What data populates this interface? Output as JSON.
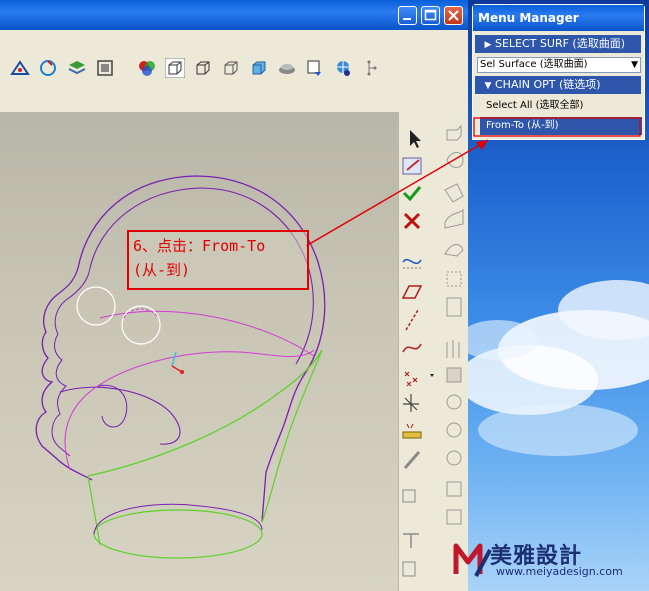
{
  "menu": {
    "title": "Menu Manager",
    "select_surf": "SELECT SURF (选取曲面)",
    "sel_surface": "Sel Surface (选取曲面)",
    "chain_opt": "CHAIN OPT (链选项)",
    "items": [
      {
        "label": "Select All (选取全部)",
        "highlighted": false
      },
      {
        "label": "From-To (从-到)",
        "highlighted": true
      }
    ]
  },
  "annotation": {
    "line1": "6、点击：From-To",
    "line2": "(从-到)",
    "color": "#e00000"
  },
  "watermark": {
    "text": "美雅設計",
    "url": "www.meiyadesign.com"
  },
  "colors": {
    "head_outline": "#7a1fb0",
    "neck_curve": "#5fd02a",
    "inner_curve": "#d23bd2",
    "accent_blue": "#2e57ac"
  },
  "window_buttons": [
    "minimize-icon",
    "maximize-icon",
    "close-icon"
  ]
}
